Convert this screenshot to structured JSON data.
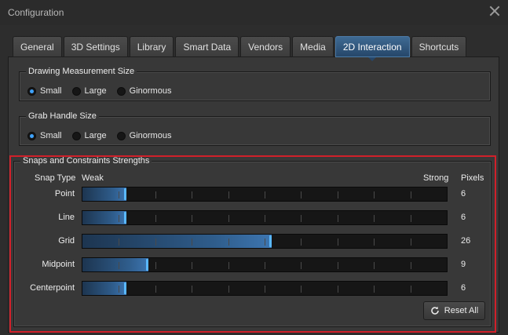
{
  "window": {
    "title": "Configuration"
  },
  "tabs": [
    {
      "label": "General"
    },
    {
      "label": "3D Settings"
    },
    {
      "label": "Library"
    },
    {
      "label": "Smart Data"
    },
    {
      "label": "Vendors"
    },
    {
      "label": "Media"
    },
    {
      "label": "2D Interaction",
      "active": true
    },
    {
      "label": "Shortcuts"
    }
  ],
  "drawing_measurement": {
    "title": "Drawing Measurement Size",
    "options": [
      "Small",
      "Large",
      "Ginormous"
    ],
    "selected": "Small"
  },
  "grab_handle": {
    "title": "Grab Handle Size",
    "options": [
      "Small",
      "Large",
      "Ginormous"
    ],
    "selected": "Small"
  },
  "snaps": {
    "title": "Snaps and Constraints Strengths",
    "col_type": "Snap Type",
    "col_weak": "Weak",
    "col_strong": "Strong",
    "col_pixels": "Pixels",
    "pixels_max": 50,
    "rows": [
      {
        "label": "Point",
        "pixels": "6"
      },
      {
        "label": "Line",
        "pixels": "6"
      },
      {
        "label": "Grid",
        "pixels": "26"
      },
      {
        "label": "Midpoint",
        "pixels": "9"
      },
      {
        "label": "Centerpoint",
        "pixels": "6"
      }
    ],
    "reset_label": "Reset All"
  },
  "colors": {
    "accent": "#3ea3ff",
    "highlight": "#d0202a",
    "tab_active": "#2f5a85"
  }
}
